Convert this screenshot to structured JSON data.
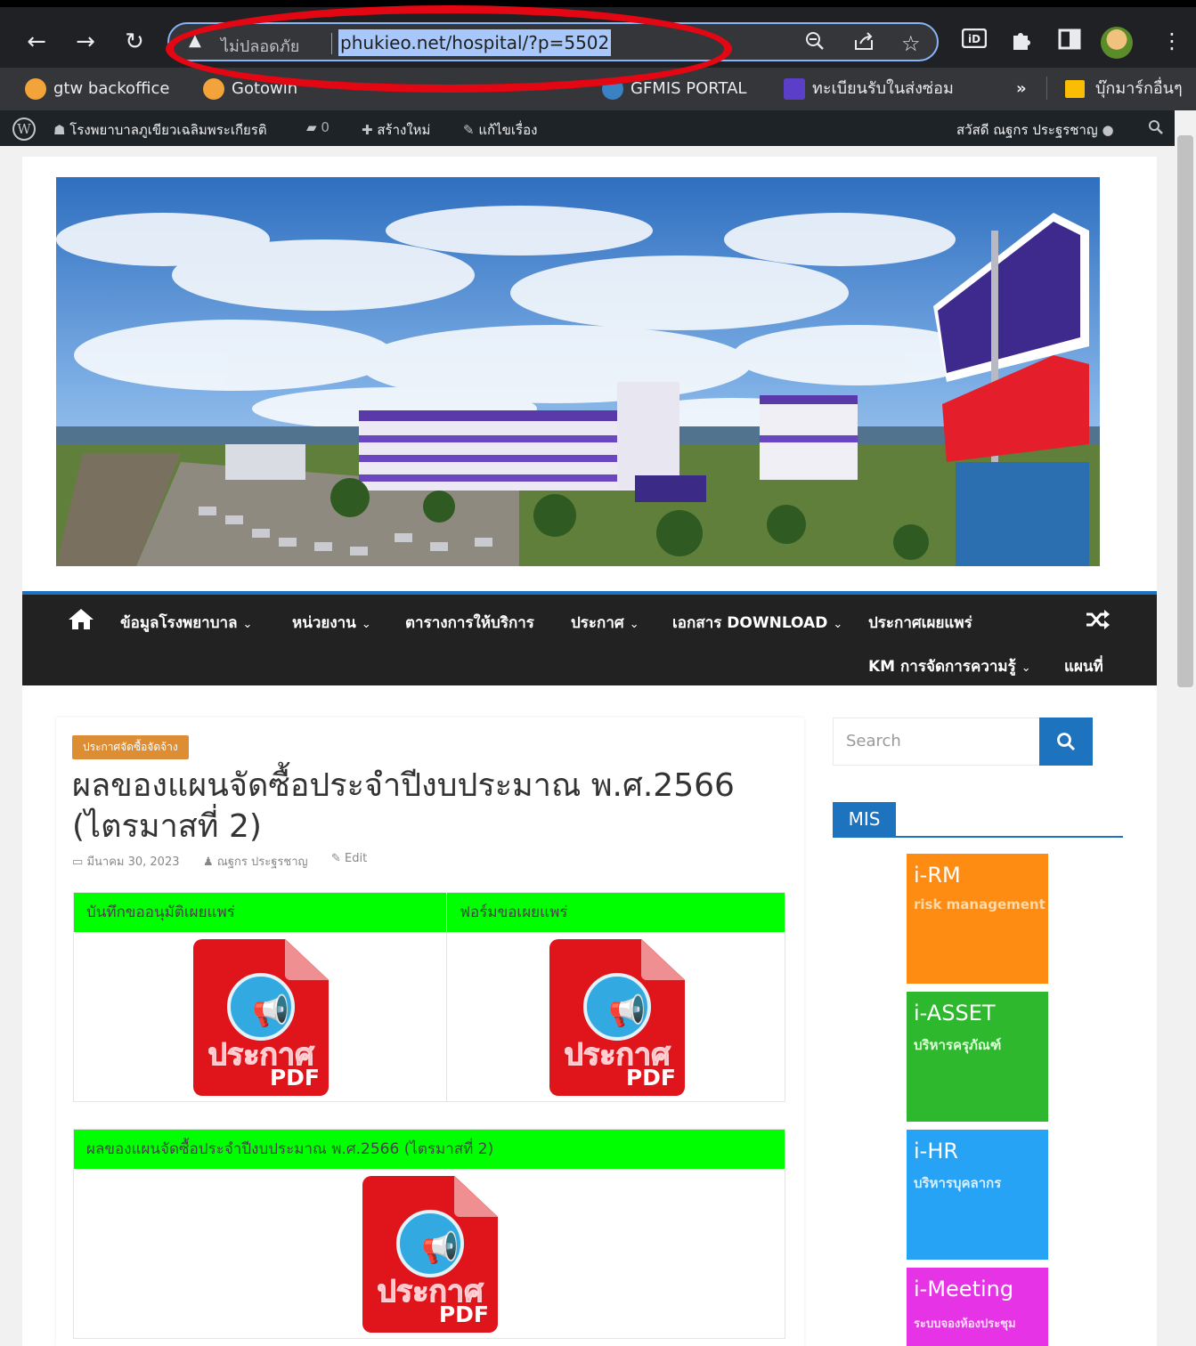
{
  "browser": {
    "security_label": "ไม่ปลอดภัย",
    "url": "phukieo.net/hospital/?p=5502",
    "icons": [
      "back-arrow-icon",
      "forward-arrow-icon",
      "reload-icon",
      "warning-icon",
      "zoom-icon",
      "share-icon",
      "star-icon",
      "id-extension-icon",
      "puzzle-icon",
      "sidepanel-icon",
      "profile-avatar",
      "menu-icon"
    ],
    "annotation_color": "#e30613"
  },
  "bookmarks": [
    {
      "label": "gtw backoffice",
      "icon": "goto-icon"
    },
    {
      "label": "Gotowin",
      "icon": "goto-icon"
    },
    {
      "label": "GFMIS PORTAL",
      "icon": "globe-icon"
    },
    {
      "label": "ทะเบียนรับในส่งซ่อม",
      "icon": "list-icon"
    }
  ],
  "bookmarks_more": "»",
  "bookmarks_other": "บุ๊กมาร์กอื่นๆ",
  "wpbar": {
    "site_name": "โรงพยาบาลภูเขียวเฉลิมพระเกียรติ",
    "comments_count": "0",
    "new_label": "สร้างใหม่",
    "edit_label": "แก้ไขเรื่อง",
    "greeting": "สวัสดี ณฐกร ประฐรชาญ"
  },
  "nav": {
    "items": [
      {
        "label": "ข้อมูลโรงพยาบาล",
        "dropdown": true
      },
      {
        "label": "หน่วยงาน",
        "dropdown": true
      },
      {
        "label": "ตารางการให้บริการ",
        "dropdown": false
      },
      {
        "label": "ประกาศ",
        "dropdown": true
      },
      {
        "label": "เอกสาร DOWNLOAD",
        "dropdown": true
      },
      {
        "label": "ประกาศเผยแพร่",
        "dropdown": false
      },
      {
        "label": "KM การจัดการความรู้",
        "dropdown": true
      },
      {
        "label": "แผนที่",
        "dropdown": false
      }
    ],
    "chevron": "⌄"
  },
  "post": {
    "category": "ประกาศจัดซื้อจัดจ้าง",
    "title": "ผลของแผนจัดซื้อประจำปีงบประมาณ พ.ศ.2566 (ไตรมาสที่ 2)",
    "date": "มีนาคม 30, 2023",
    "author": "ณฐกร ประฐรชาญ",
    "edit": "Edit",
    "table1": {
      "headers": [
        "บันทึกขออนุมัติเผยแพร่",
        "ฟอร์มขอเผยแพร่"
      ]
    },
    "table2": {
      "header": "ผลของแผนจัดซื้อประจำปีงบประมาณ พ.ศ.2566 (ไตรมาสที่ 2)"
    },
    "pdf_icon": {
      "word": "ประกาศ",
      "label": "PDF"
    },
    "header_green": "#00ff00"
  },
  "sidebar": {
    "search_placeholder": "Search",
    "mis_title": "MIS",
    "tiles": [
      {
        "name": "i-RM",
        "sub": "risk management",
        "color": "#ff8c12"
      },
      {
        "name": "i-ASSET",
        "sub": "บริหารครุภัณฑ์",
        "color": "#2eb82e"
      },
      {
        "name": "i-HR",
        "sub": "บริหารบุคลากร",
        "color": "#27a3f5"
      },
      {
        "name": "i-Meeting",
        "sub": "ระบบจองห้องประชุม",
        "color": "#e533e5"
      }
    ]
  },
  "colors": {
    "accent": "#1e73be",
    "badge": "#dd8d34",
    "nav_bg": "#222222"
  }
}
